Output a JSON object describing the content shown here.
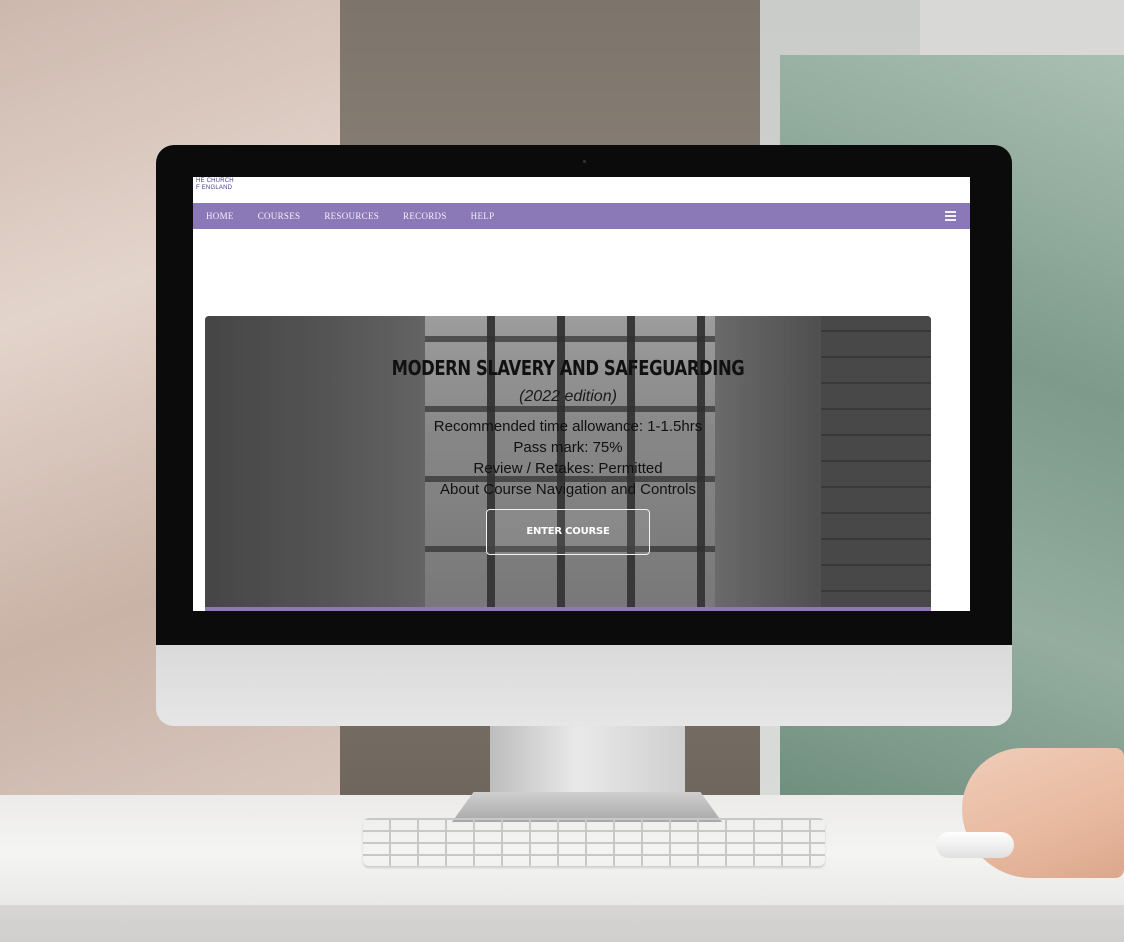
{
  "logo": {
    "line1": "HE CHURCH",
    "line2": "F ENGLAND"
  },
  "nav": {
    "items": [
      "HOME",
      "COURSES",
      "RESOURCES",
      "RECORDS",
      "HELP"
    ]
  },
  "course": {
    "title": "MODERN SLAVERY AND SAFEGUARDING",
    "edition": "(2022 edition)",
    "time_allowance": "Recommended time allowance: 1-1.5hrs",
    "pass_mark": "Pass mark: 75%",
    "review": "Review / Retakes: Permitted",
    "about_link": "About Course Navigation and Controls",
    "enter_label": "ENTER COURSE"
  },
  "colors": {
    "nav_bg": "#8a79b6",
    "logo": "#4a3f8a"
  }
}
